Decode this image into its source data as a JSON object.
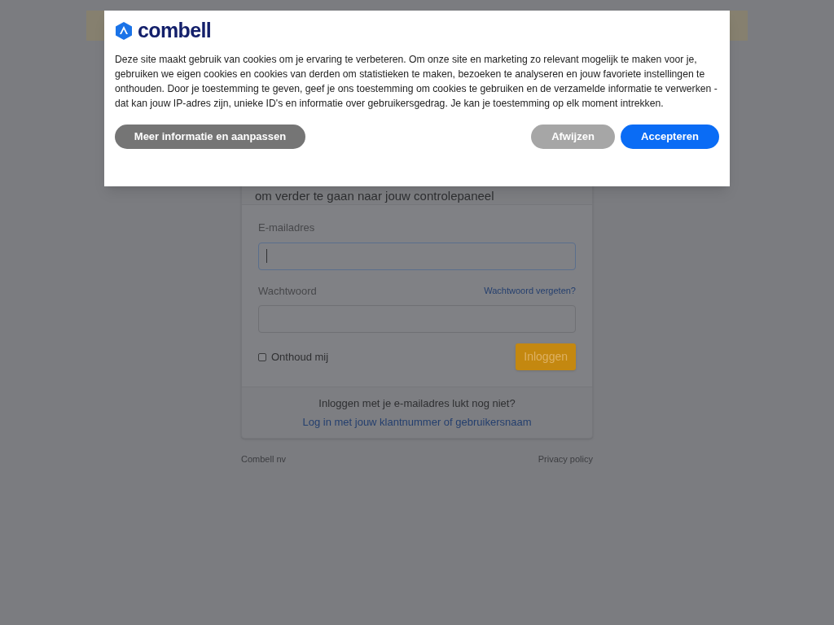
{
  "cookie_dialog": {
    "brand": "combell",
    "message": "Deze site maakt gebruik van cookies om je ervaring te verbeteren. Om onze site en marketing zo relevant mogelijk te maken voor je, gebruiken we eigen cookies en cookies van derden om statistieken te maken, bezoeken te analyseren en jouw favoriete instellingen te onthouden. Door je toestemming te geven, geef je ons toestemming om cookies te gebruiken en de verzamelde informatie te verwerken - dat kan jouw IP-adres zijn, unieke ID's en informatie over gebruikersgedrag. Je kan je toestemming op elk moment intrekken.",
    "buttons": [
      {
        "label": "Meer informatie en aanpassen",
        "kind": "secondary"
      },
      {
        "label": "Afwijzen",
        "kind": "muted"
      },
      {
        "label": "Accepteren",
        "kind": "primary"
      }
    ]
  },
  "login_card": {
    "subtitle": "om verder te gaan naar jouw controlepaneel",
    "email": {
      "label": "E-mailadres",
      "focused": true
    },
    "password": {
      "label": "Wachtwoord",
      "link": "Wachtwoord vergeten?"
    },
    "remember": {
      "label": "Onthoud mij",
      "checked": false
    },
    "submit": "Inloggen",
    "alt_text": "Inloggen met je e-mailadres lukt nog niet?",
    "alt_link": "Log in met jouw klantnummer of gebruikersnaam"
  },
  "footer": {
    "company": "Combell nv",
    "privacy": "Privacy policy"
  }
}
